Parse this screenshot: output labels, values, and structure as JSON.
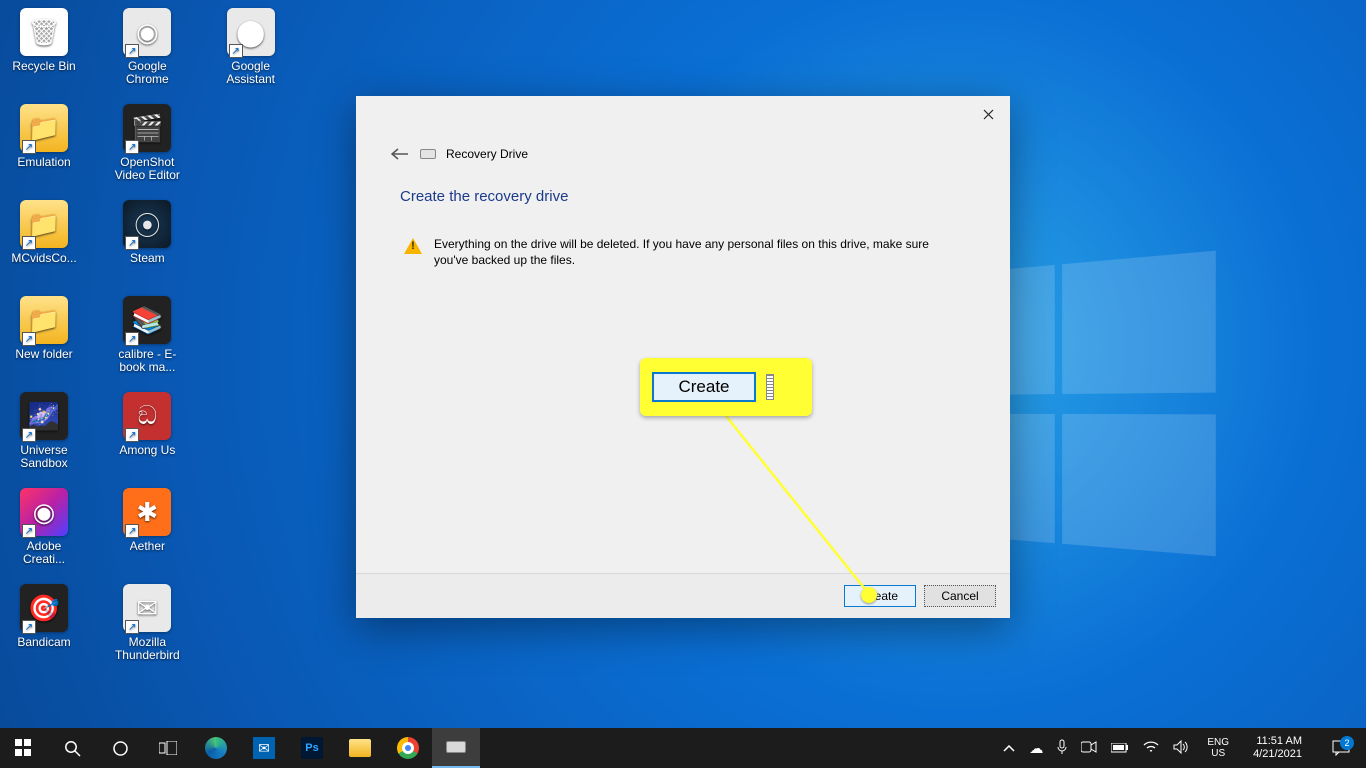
{
  "desktop": {
    "icons": [
      {
        "label": "Recycle Bin",
        "glyph": "🗑",
        "cls": "white-bin"
      },
      {
        "label": "Emulation",
        "glyph": "📁",
        "cls": "yellow-folder"
      },
      {
        "label": "MCvidsCo...",
        "glyph": "📁",
        "cls": "yellow-folder"
      },
      {
        "label": "New folder",
        "glyph": "📁",
        "cls": "yellow-folder"
      },
      {
        "label": "Universe Sandbox",
        "glyph": "🌌",
        "cls": "dark"
      },
      {
        "label": "Adobe Creati...",
        "glyph": "◉",
        "cls": "adobe"
      },
      {
        "label": "Bandicam",
        "glyph": "🎯",
        "cls": "dark"
      },
      {
        "label": "Google Chrome",
        "glyph": "◉",
        "cls": "flat"
      },
      {
        "label": "OpenShot Video Editor",
        "glyph": "🎬",
        "cls": "dark"
      },
      {
        "label": "Steam",
        "glyph": "⦿",
        "cls": "steam"
      },
      {
        "label": "calibre - E-book ma...",
        "glyph": "📚",
        "cls": "dark"
      },
      {
        "label": "Among Us",
        "glyph": "ඞ",
        "cls": "red"
      },
      {
        "label": "Aether",
        "glyph": "✱",
        "cls": "orange"
      },
      {
        "label": "Mozilla Thunderbird",
        "glyph": "✉",
        "cls": "flat"
      },
      {
        "label": "Google Assistant",
        "glyph": "⬤",
        "cls": "flat"
      }
    ]
  },
  "dialog": {
    "title": "Recovery Drive",
    "heading": "Create the recovery drive",
    "warning": "Everything on the drive will be deleted. If you have any personal files on this drive, make sure you've backed up the files.",
    "create_label": "Create",
    "cancel_label": "Cancel"
  },
  "callout": {
    "label": "Create"
  },
  "taskbar": {
    "lang_line1": "ENG",
    "lang_line2": "US",
    "time": "11:51 AM",
    "date": "4/21/2021",
    "notif_count": "2"
  }
}
